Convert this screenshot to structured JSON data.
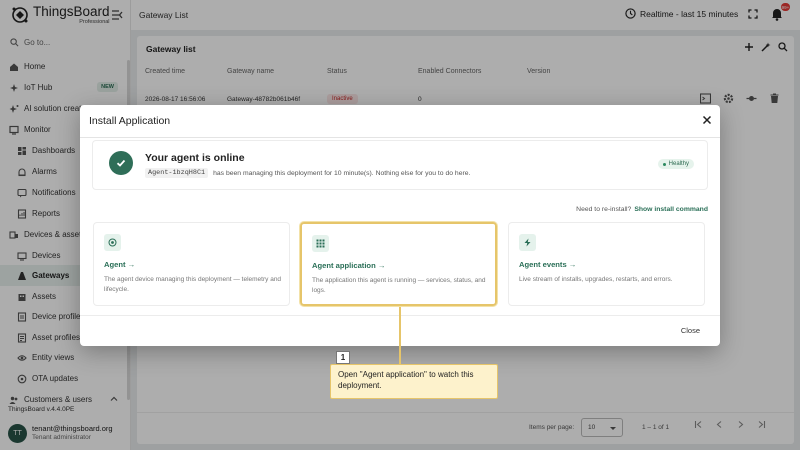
{
  "sidebar": {
    "logo": {
      "name": "ThingsBoard",
      "sub": "Professional"
    },
    "search_placeholder": "Go to...",
    "items": [
      {
        "label": "Home",
        "icon": "home-icon"
      },
      {
        "label": "IoT Hub",
        "icon": "puzzle-icon",
        "badge": "NEW"
      },
      {
        "label": "AI solution creator",
        "icon": "sparkle-icon"
      },
      {
        "label": "Monitor",
        "icon": "monitor-icon"
      },
      {
        "label": "Dashboards",
        "icon": "dashboard-icon"
      },
      {
        "label": "Alarms",
        "icon": "alarm-icon"
      },
      {
        "label": "Notifications",
        "icon": "notifications-icon"
      },
      {
        "label": "Reports",
        "icon": "reports-icon"
      },
      {
        "label": "Devices & assets",
        "icon": "devices-assets-icon"
      },
      {
        "label": "Devices",
        "icon": "device-icon"
      },
      {
        "label": "Gateways",
        "icon": "gateway-icon"
      },
      {
        "label": "Assets",
        "icon": "asset-icon"
      },
      {
        "label": "Device profiles",
        "icon": "device-profile-icon"
      },
      {
        "label": "Asset profiles",
        "icon": "asset-profile-icon"
      },
      {
        "label": "Entity views",
        "icon": "entity-view-icon"
      },
      {
        "label": "OTA updates",
        "icon": "ota-icon"
      },
      {
        "label": "Customers & users",
        "icon": "users-icon"
      }
    ],
    "version": "ThingsBoard v.4.4.0PE",
    "user": {
      "initials": "TT",
      "email": "tenant@thingsboard.org",
      "role": "Tenant administrator"
    }
  },
  "topbar": {
    "page_title": "Gateway List",
    "realtime": "Realtime - last 15 minutes",
    "notification_count": "99+"
  },
  "table": {
    "title": "Gateway list",
    "columns": [
      "Created time",
      "Gateway name",
      "Status",
      "Enabled Connectors",
      "Version"
    ],
    "rows": [
      {
        "created": "2026-08-17 16:56:06",
        "name": "Gateway-48782b061b46f",
        "status": "Inactive",
        "connectors": "0",
        "version": ""
      }
    ],
    "pager": {
      "label": "Items per page:",
      "per_page": "10",
      "range": "1 – 1 of 1"
    }
  },
  "dialog": {
    "title": "Install Application",
    "status_title": "Your agent is online",
    "agent_id": "Agent-1bzqH8C1",
    "status_text": "has been managing this deployment for 10 minute(s). Nothing else for you to do here.",
    "health": "Healthy",
    "reinstall_text": "Need to re-install?",
    "reinstall_link": "Show install command",
    "options": [
      {
        "title": "Agent →",
        "desc": "The agent device managing this deployment — telemetry and lifecycle.",
        "icon": "target-icon"
      },
      {
        "title": "Agent application →",
        "desc": "The application this agent is running — services, status, and logs.",
        "icon": "app-grid-icon"
      },
      {
        "title": "Agent events →",
        "desc": "Live stream of installs, upgrades, restarts, and errors.",
        "icon": "bolt-icon"
      }
    ],
    "close": "Close"
  },
  "tutorial": {
    "step": "1",
    "text": "Open \"Agent application\" to watch this deployment."
  },
  "colors": {
    "brand": "#285347",
    "accent": "#2a6f57",
    "highlight": "#e6c56a",
    "callout_bg": "#fdf2cc",
    "inactive": "#c62828"
  }
}
